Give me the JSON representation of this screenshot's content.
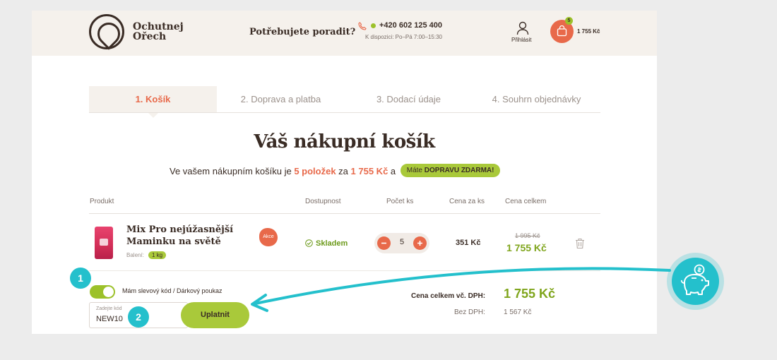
{
  "brand": {
    "name_line1": "Ochutnej",
    "name_line2": "Ořech"
  },
  "header": {
    "help_question": "Potřebujete poradit?",
    "phone": "+420 602 125 400",
    "hours": "K dispozici: Po–Pá 7:00–15:30",
    "login_label": "Přihlásit",
    "cart_count": "5",
    "cart_total": "1 755 Kč"
  },
  "steps": [
    "1. Košík",
    "2. Doprava a platba",
    "3. Dodací údaje",
    "4. Souhrn objednávky"
  ],
  "title": "Váš nákupní košík",
  "summary": {
    "pre": "Ve vašem nákupním košíku je ",
    "items": "5 položek",
    "mid": " za ",
    "price": "1 755 Kč",
    "post": " a ",
    "badge_pre": "Máte ",
    "badge_bold": "DOPRAVU ZDARMA!"
  },
  "table": {
    "headers": [
      "Produkt",
      "Dostupnost",
      "Počet ks",
      "Cena za ks",
      "Cena celkem"
    ],
    "rows": [
      {
        "name": "Mix Pro nejúžasnější Maminku na světě",
        "packaging_label": "Balení:",
        "packaging": "1 kg",
        "promo": "Akce",
        "availability": "Skladem",
        "quantity": "5",
        "unit_price": "351 Kč",
        "old_price": "1 995 Kč",
        "total_price": "1 755 Kč"
      }
    ]
  },
  "coupon": {
    "toggle_label": "Mám slevový kód / Dárkový poukaz",
    "input_placeholder": "Zadejte kód",
    "input_value": "NEW10",
    "apply_label": "Uplatnit"
  },
  "totals": {
    "total_label": "Cena celkem vč. DPH:",
    "total_value": "1 755 Kč",
    "net_label": "Bez DPH:",
    "net_value": "1 567 Kč"
  },
  "markers": [
    "1",
    "2"
  ],
  "colors": {
    "accent": "#e8694a",
    "green": "#9cc12a",
    "teal": "#24c0cc",
    "cream": "#f5f1ec"
  },
  "icons": [
    "logo-icon",
    "phone-icon",
    "user-icon",
    "cart-icon",
    "check-circle-icon",
    "minus-icon",
    "plus-icon",
    "trash-icon",
    "piggy-bank-icon"
  ]
}
